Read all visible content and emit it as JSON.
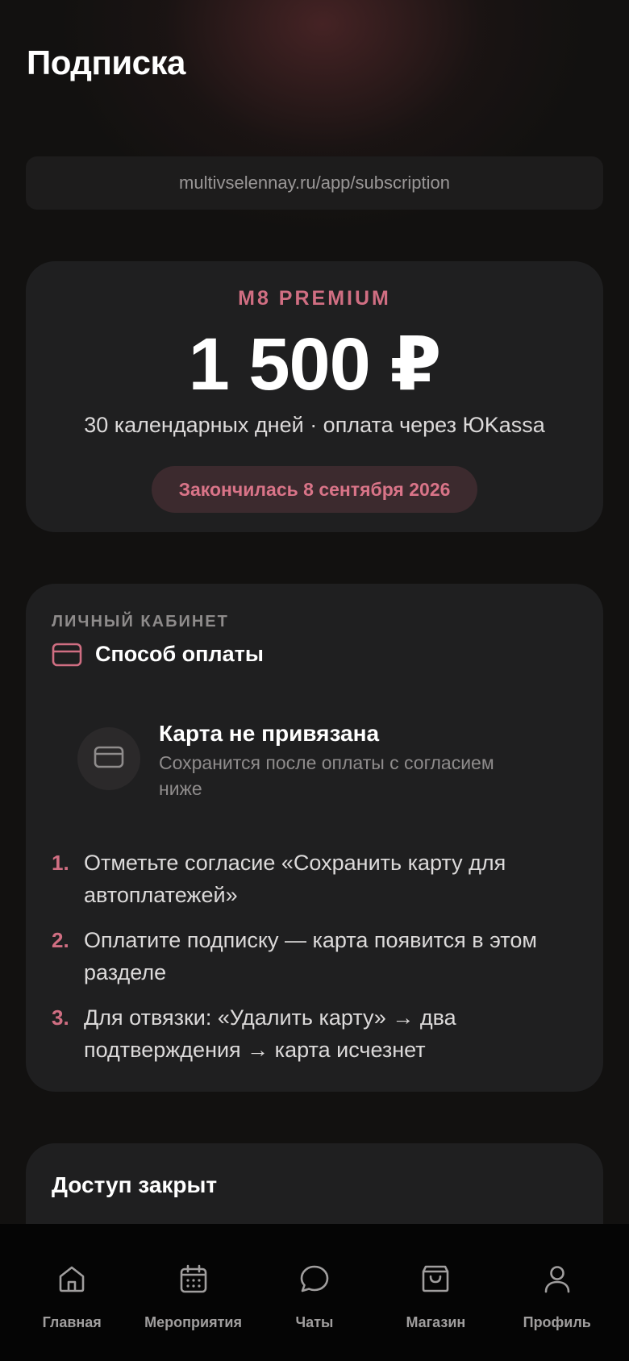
{
  "header": {
    "title": "Подписка"
  },
  "url_bar": {
    "url": "multivselennay.ru/app/subscription"
  },
  "plan": {
    "name": "M8 PREMIUM",
    "price": "1 500 ₽",
    "description": "30 календарных дней · оплата через ЮKassa",
    "status_badge": "Закончилась 8 сентября 2026",
    "accent_color": "#d06e82"
  },
  "payment": {
    "section_label": "ЛИЧНЫЙ КАБИНЕТ",
    "title": "Способ оплаты",
    "title_icon": "credit-card-icon",
    "card_status": {
      "icon": "credit-card-icon",
      "title": "Карта не привязана",
      "hint": "Сохранится после оплаты с согласием ниже"
    },
    "steps": [
      {
        "num": "1.",
        "text": "Отметьте согласие «Сохранить карту для автоплатежей»"
      },
      {
        "num": "2.",
        "text": "Оплатите подписку — карта появится в этом разделе"
      },
      {
        "num": "3.",
        "text": "Для отвязки: «Удалить карту» → два подтверждения → карта исчезнет"
      }
    ]
  },
  "access": {
    "title": "Доступ закрыт"
  },
  "tab_bar": {
    "items": [
      {
        "label": "Главная",
        "icon": "home-icon"
      },
      {
        "label": "Мероприятия",
        "icon": "calendar-icon"
      },
      {
        "label": "Чаты",
        "icon": "chat-bubble-icon"
      },
      {
        "label": "Магазин",
        "icon": "shopping-bag-icon"
      },
      {
        "label": "Профиль",
        "icon": "user-icon"
      }
    ]
  }
}
